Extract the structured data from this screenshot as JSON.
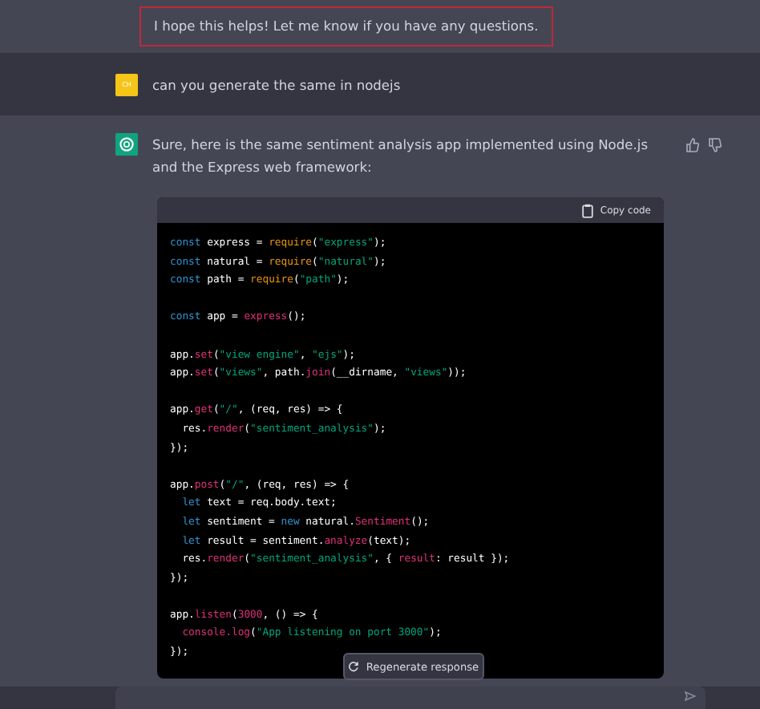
{
  "previous_reply": {
    "text": "I hope this helps! Let me know if you have any questions.",
    "highlighted": true
  },
  "user_message": {
    "initials": "CH",
    "text": "can you generate the same in nodejs"
  },
  "assistant_message": {
    "text": "Sure, here is the same sentiment analysis app implemented using Node.js and the Express web framework:",
    "code": {
      "copy_label": "Copy code",
      "blocks": [
        [
          {
            "indented": false,
            "tokens": [
              {
                "text": "const",
                "kind": "keyword"
              },
              {
                "text": " express = ",
                "kind": "plain"
              },
              {
                "text": "require",
                "kind": "builtin"
              },
              {
                "text": "(",
                "kind": "plain"
              },
              {
                "text": "\"express\"",
                "kind": "string"
              },
              {
                "text": ");",
                "kind": "plain"
              }
            ]
          },
          {
            "indented": false,
            "tokens": [
              {
                "text": "const",
                "kind": "keyword"
              },
              {
                "text": " natural = ",
                "kind": "plain"
              },
              {
                "text": "require",
                "kind": "builtin"
              },
              {
                "text": "(",
                "kind": "plain"
              },
              {
                "text": "\"natural\"",
                "kind": "string"
              },
              {
                "text": ");",
                "kind": "plain"
              }
            ]
          },
          {
            "indented": false,
            "tokens": [
              {
                "text": "const",
                "kind": "keyword"
              },
              {
                "text": " path = ",
                "kind": "plain"
              },
              {
                "text": "require",
                "kind": "builtin"
              },
              {
                "text": "(",
                "kind": "plain"
              },
              {
                "text": "\"path\"",
                "kind": "string"
              },
              {
                "text": ");",
                "kind": "plain"
              }
            ]
          }
        ],
        [
          {
            "indented": false,
            "tokens": [
              {
                "text": "const",
                "kind": "keyword"
              },
              {
                "text": " app = ",
                "kind": "plain"
              },
              {
                "text": "express",
                "kind": "call"
              },
              {
                "text": "();",
                "kind": "plain"
              }
            ]
          }
        ],
        [
          {
            "indented": false,
            "tokens": [
              {
                "text": "app.",
                "kind": "plain"
              },
              {
                "text": "set",
                "kind": "call"
              },
              {
                "text": "(",
                "kind": "plain"
              },
              {
                "text": "\"view engine\"",
                "kind": "string"
              },
              {
                "text": ", ",
                "kind": "plain"
              },
              {
                "text": "\"ejs\"",
                "kind": "string"
              },
              {
                "text": ");",
                "kind": "plain"
              }
            ]
          },
          {
            "indented": false,
            "tokens": [
              {
                "text": "app.",
                "kind": "plain"
              },
              {
                "text": "set",
                "kind": "call"
              },
              {
                "text": "(",
                "kind": "plain"
              },
              {
                "text": "\"views\"",
                "kind": "string"
              },
              {
                "text": ", path.",
                "kind": "plain"
              },
              {
                "text": "join",
                "kind": "call"
              },
              {
                "text": "(__dirname, ",
                "kind": "plain"
              },
              {
                "text": "\"views\"",
                "kind": "string"
              },
              {
                "text": "));",
                "kind": "plain"
              }
            ]
          }
        ],
        [
          {
            "indented": false,
            "tokens": [
              {
                "text": "app.",
                "kind": "plain"
              },
              {
                "text": "get",
                "kind": "call"
              },
              {
                "text": "(",
                "kind": "plain"
              },
              {
                "text": "\"/\"",
                "kind": "string"
              },
              {
                "text": ", (req, res) => {",
                "kind": "plain"
              }
            ]
          },
          {
            "indented": true,
            "tokens": [
              {
                "text": "res.",
                "kind": "plain"
              },
              {
                "text": "render",
                "kind": "call"
              },
              {
                "text": "(",
                "kind": "plain"
              },
              {
                "text": "\"sentiment_analysis\"",
                "kind": "string"
              },
              {
                "text": ");",
                "kind": "plain"
              }
            ]
          },
          {
            "indented": false,
            "tokens": [
              {
                "text": "});",
                "kind": "plain"
              }
            ]
          }
        ],
        [
          {
            "indented": false,
            "tokens": [
              {
                "text": "app.",
                "kind": "plain"
              },
              {
                "text": "post",
                "kind": "call"
              },
              {
                "text": "(",
                "kind": "plain"
              },
              {
                "text": "\"/\"",
                "kind": "string"
              },
              {
                "text": ", (req, res) => {",
                "kind": "plain"
              }
            ]
          },
          {
            "indented": true,
            "tokens": [
              {
                "text": "let",
                "kind": "keyword"
              },
              {
                "text": " text = req.body.text;",
                "kind": "plain"
              }
            ]
          },
          {
            "indented": true,
            "tokens": [
              {
                "text": "let",
                "kind": "keyword"
              },
              {
                "text": " sentiment = ",
                "kind": "plain"
              },
              {
                "text": "new",
                "kind": "keyword"
              },
              {
                "text": " natural.",
                "kind": "plain"
              },
              {
                "text": "Sentiment",
                "kind": "call"
              },
              {
                "text": "();",
                "kind": "plain"
              }
            ]
          },
          {
            "indented": true,
            "tokens": [
              {
                "text": "let",
                "kind": "keyword"
              },
              {
                "text": " result = sentiment.",
                "kind": "plain"
              },
              {
                "text": "analyze",
                "kind": "call"
              },
              {
                "text": "(text);",
                "kind": "plain"
              }
            ]
          },
          {
            "indented": true,
            "tokens": [
              {
                "text": "res.",
                "kind": "plain"
              },
              {
                "text": "render",
                "kind": "call"
              },
              {
                "text": "(",
                "kind": "plain"
              },
              {
                "text": "\"sentiment_analysis\"",
                "kind": "string"
              },
              {
                "text": ", { ",
                "kind": "plain"
              },
              {
                "text": "result",
                "kind": "call"
              },
              {
                "text": ": result });",
                "kind": "plain"
              }
            ]
          },
          {
            "indented": false,
            "tokens": [
              {
                "text": "});",
                "kind": "plain"
              }
            ]
          }
        ],
        [
          {
            "indented": false,
            "tokens": [
              {
                "text": "app.",
                "kind": "plain"
              },
              {
                "text": "listen",
                "kind": "call"
              },
              {
                "text": "(",
                "kind": "plain"
              },
              {
                "text": "3000",
                "kind": "call"
              },
              {
                "text": ", () => {",
                "kind": "plain"
              }
            ]
          },
          {
            "indented": true,
            "tokens": [
              {
                "text": "console.log",
                "kind": "call"
              },
              {
                "text": "(",
                "kind": "plain"
              },
              {
                "text": "\"App listening on port 3000\"",
                "kind": "string"
              },
              {
                "text": ");",
                "kind": "plain"
              }
            ]
          },
          {
            "indented": false,
            "tokens": [
              {
                "text": "});",
                "kind": "plain"
              }
            ]
          }
        ]
      ]
    }
  },
  "regenerate_button": {
    "label": "Regenerate response"
  }
}
